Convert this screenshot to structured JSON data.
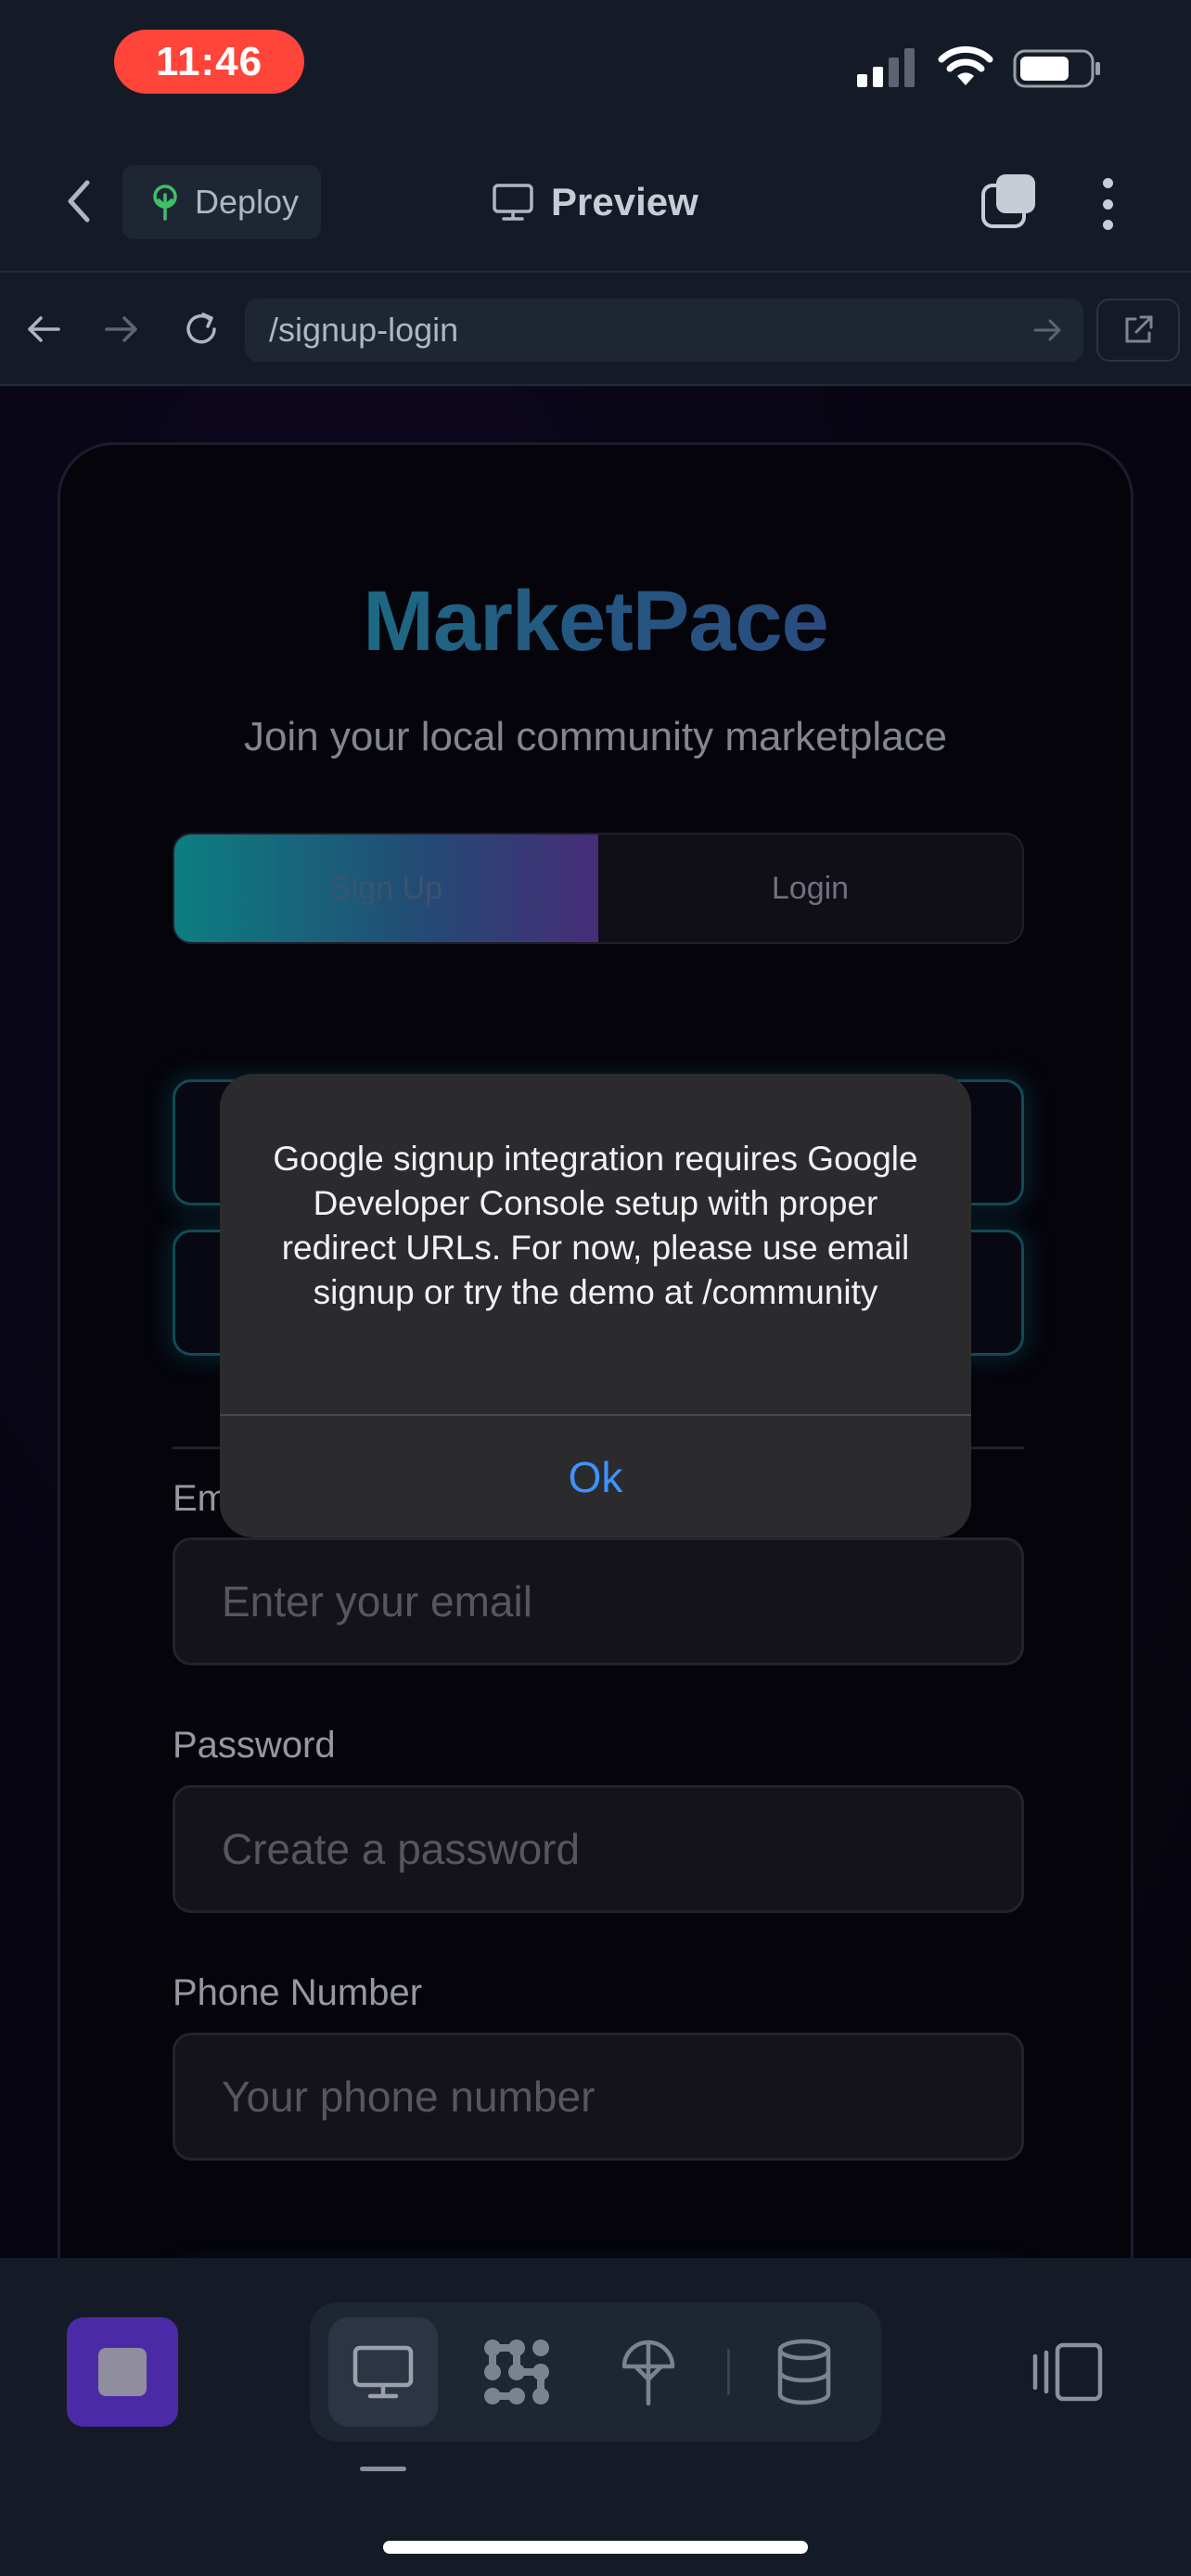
{
  "status_bar": {
    "time": "11:46"
  },
  "header": {
    "deploy_label": "Deploy",
    "preview_title": "Preview"
  },
  "browser": {
    "url": "/signup-login"
  },
  "page": {
    "brand": "MarketPace",
    "tagline": "Join your local community marketplace",
    "tabs": [
      {
        "label": "Sign Up",
        "active": true
      },
      {
        "label": "Login",
        "active": false
      }
    ],
    "fields": {
      "email_label": "Email",
      "email_placeholder": "Enter your email",
      "password_label": "Password",
      "password_placeholder": "Create a password",
      "phone_label": "Phone Number",
      "phone_placeholder": "Your phone number"
    }
  },
  "alert": {
    "message": "Google signup integration requires Google Developer Console setup with proper redirect URLs. For now, please use email signup or try the demo at /community",
    "ok_label": "Ok"
  },
  "colors": {
    "status_time_pill": "#ff453a",
    "accent_teal": "#1aa6a8",
    "accent_purple": "#5b3a9a",
    "alert_button": "#3f93ff",
    "stop_button": "#4b2aa8"
  },
  "toolbar": {
    "tools": [
      "preview-icon",
      "workflow-icon",
      "deployments-icon",
      "database-icon"
    ]
  }
}
